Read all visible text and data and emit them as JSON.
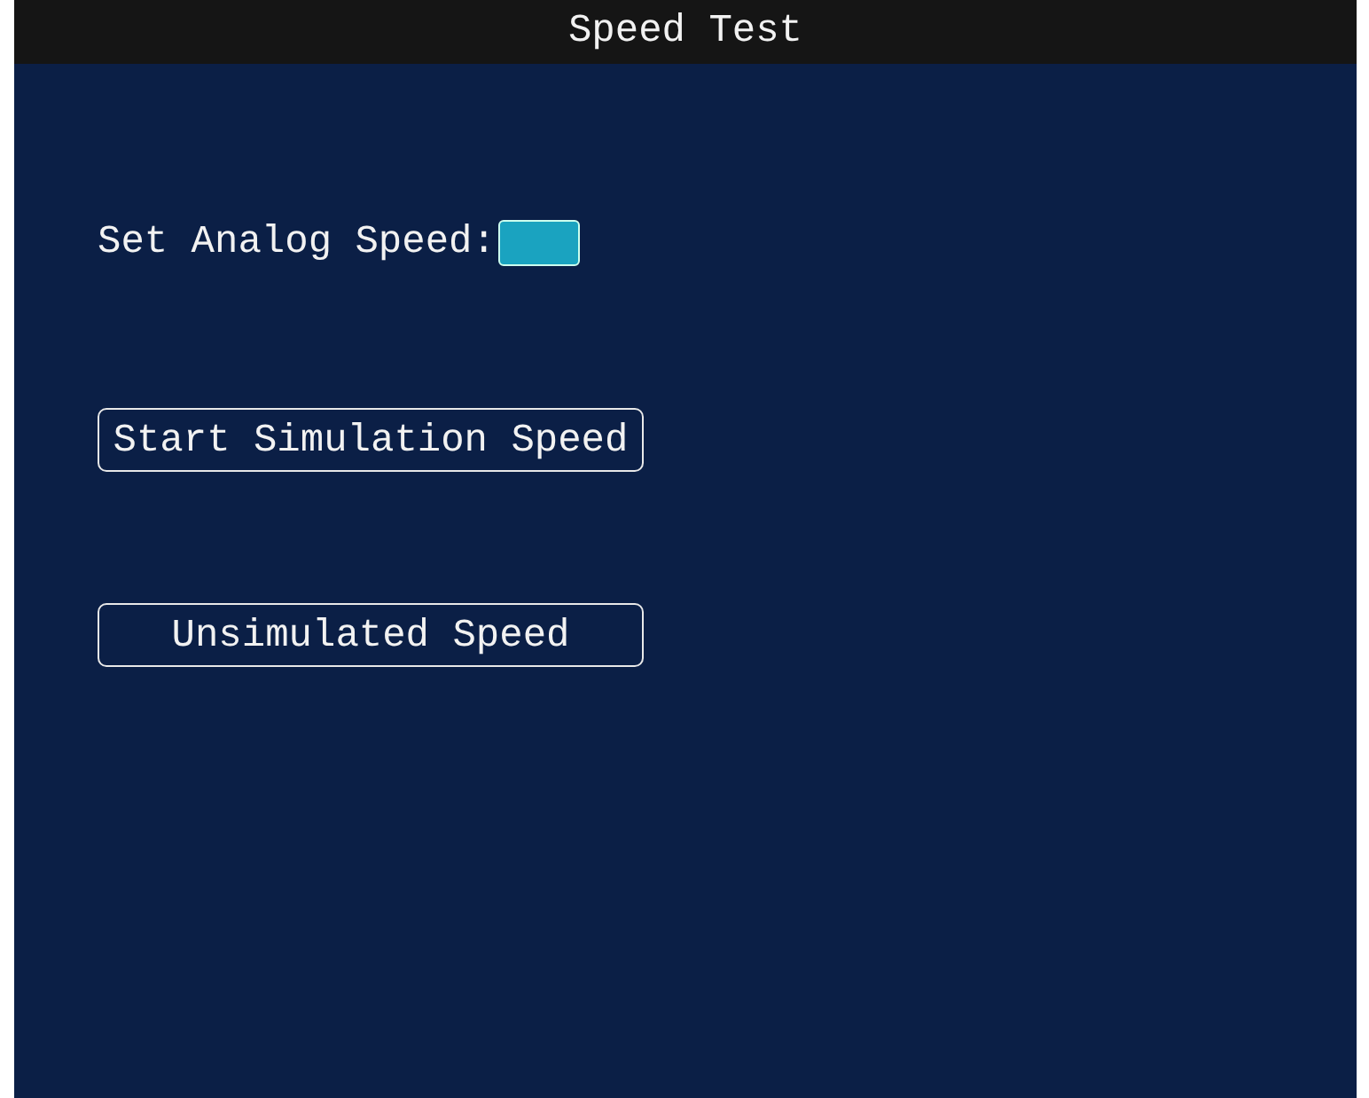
{
  "window": {
    "title": "Speed Test"
  },
  "speed_field": {
    "label": "Set Analog Speed:",
    "selected": true
  },
  "buttons": [
    {
      "label": "Start Simulation Speed"
    },
    {
      "label": "Unsimulated Speed"
    }
  ]
}
